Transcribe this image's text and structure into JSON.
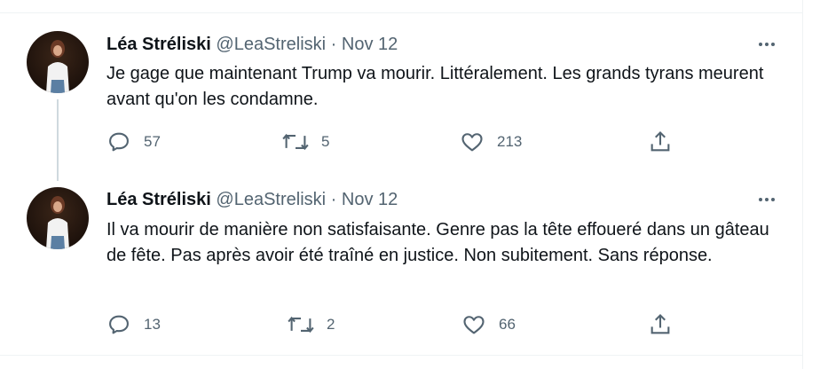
{
  "tweets": [
    {
      "author": {
        "name": "Léa Stréliski",
        "handle": "@LeaStreliski",
        "separator": "·",
        "date": "Nov 12"
      },
      "text": "Je gage que maintenant Trump va mourir. Littéralement. Les grands tyrans meurent avant qu'on les condamne.",
      "actions": {
        "replies": "57",
        "retweets": "5",
        "likes": "213"
      }
    },
    {
      "author": {
        "name": "Léa Stréliski",
        "handle": "@LeaStreliski",
        "separator": "·",
        "date": "Nov 12"
      },
      "text": "Il va mourir de manière non satisfaisante. Genre pas la tête effoueré dans un gâteau de fête. Pas après avoir été traîné en justice. Non subitement. Sans réponse.",
      "actions": {
        "replies": "13",
        "retweets": "2",
        "likes": "66"
      }
    }
  ],
  "icons": {
    "reply": "speech-bubble-icon",
    "retweet": "retweet-icon",
    "like": "heart-icon",
    "share": "share-icon",
    "more": "more-horizontal-icon"
  },
  "colors": {
    "text": "#0f1419",
    "secondary": "#536471",
    "border": "#eff3f4",
    "thread_line": "#cfd9de"
  }
}
